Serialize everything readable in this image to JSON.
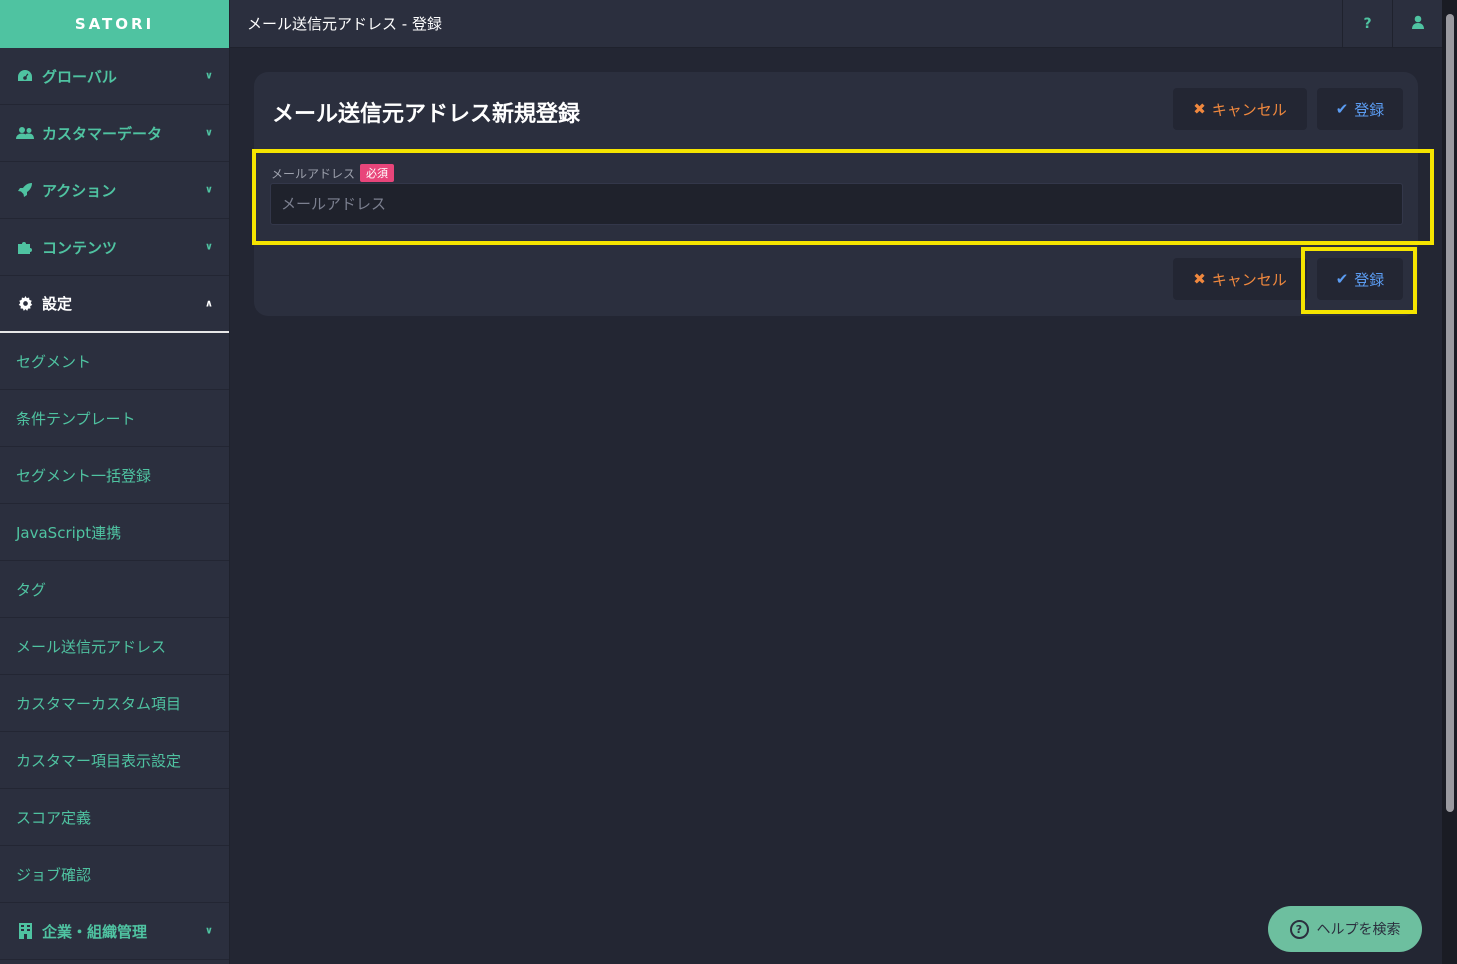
{
  "app": {
    "logo": "SATORI"
  },
  "topbar": {
    "title": "メール送信元アドレス - 登録",
    "help_label": "?",
    "user_icon": "user-icon"
  },
  "sidebar": {
    "sections_top": [
      {
        "label": "グローバル",
        "icon": "dashboard-icon"
      },
      {
        "label": "カスタマーデータ",
        "icon": "users-icon"
      },
      {
        "label": "アクション",
        "icon": "rocket-icon"
      },
      {
        "label": "コンテンツ",
        "icon": "puzzle-icon"
      }
    ],
    "open_section": {
      "label": "設定",
      "icon": "gear-icon"
    },
    "sub_items": [
      "セグメント",
      "条件テンプレート",
      "セグメント一括登録",
      "JavaScript連携",
      "タグ",
      "メール送信元アドレス",
      "カスタマーカスタム項目",
      "カスタマー項目表示設定",
      "スコア定義",
      "ジョブ確認"
    ],
    "bottom_section": {
      "label": "企業・組織管理",
      "icon": "building-icon"
    }
  },
  "form": {
    "title": "メール送信元アドレス新規登録",
    "cancel_label": "キャンセル",
    "submit_label": "登録",
    "email_label": "メールアドレス",
    "required_badge": "必須",
    "email_placeholder": "メールアドレス",
    "email_value": ""
  },
  "help": {
    "label": "ヘルプを検索",
    "icon_text": "?"
  },
  "colors": {
    "accent": "#4fc3a1",
    "cancel": "#f0883e",
    "submit": "#5b9cf2",
    "highlight": "#f5e400",
    "badge": "#e8457a"
  }
}
